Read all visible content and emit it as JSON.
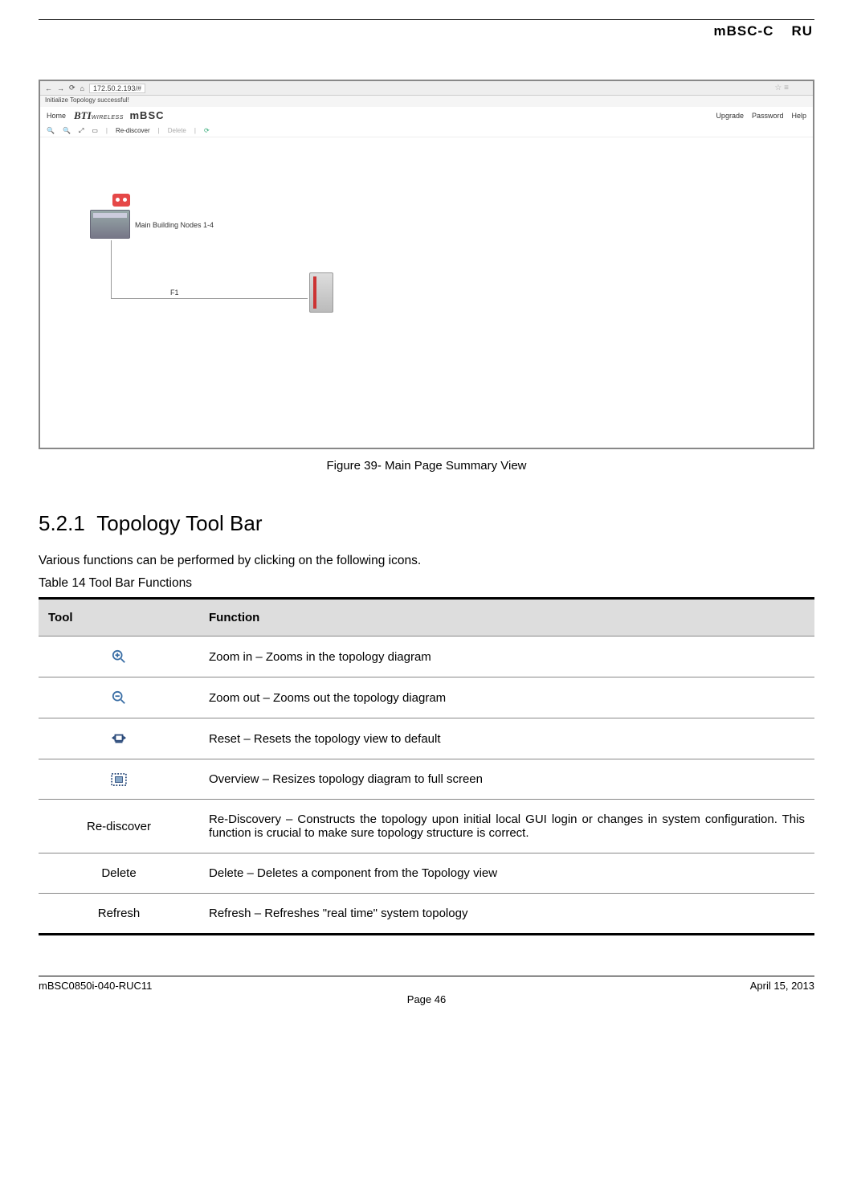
{
  "header": {
    "product": "mBSC-C",
    "unit": "RU"
  },
  "screenshot": {
    "address_bar": "172.50.2.193/#",
    "status_text": "Initialize Topology successful!",
    "top_menu_left": {
      "home": "Home",
      "brand_bti": "BTI",
      "brand_wl": "WIRELESS",
      "brand_mbsc": "mBSC"
    },
    "top_menu_right": {
      "upgrade": "Upgrade",
      "password": "Password",
      "help": "Help"
    },
    "toolbar": {
      "rediscover": "Re-discover",
      "delete": "Delete"
    },
    "host_label": "Main Building Nodes 1-4",
    "f1_label": "F1"
  },
  "figure_caption": "Figure 39- Main Page Summary View",
  "section": {
    "number": "5.2.1",
    "title": "Topology Tool Bar"
  },
  "body_para": "Various functions can be performed by clicking on the following icons.",
  "table_caption": "Table 14 Tool Bar Functions",
  "table": {
    "head_tool": "Tool",
    "head_func": "Function",
    "rows": [
      {
        "tool_type": "icon",
        "icon": "zoom-in",
        "tool_text": "",
        "func": "Zoom in – Zooms in the topology diagram"
      },
      {
        "tool_type": "icon",
        "icon": "zoom-out",
        "tool_text": "",
        "func": "Zoom out – Zooms out the topology diagram"
      },
      {
        "tool_type": "icon",
        "icon": "reset",
        "tool_text": "",
        "func": "Reset – Resets the topology view to default"
      },
      {
        "tool_type": "icon",
        "icon": "overview",
        "tool_text": "",
        "func": "Overview – Resizes topology diagram to full screen"
      },
      {
        "tool_type": "text",
        "icon": "",
        "tool_text": "Re-discover",
        "func": "Re-Discovery – Constructs the topology upon initial local GUI login or changes in system configuration. This function is crucial to make sure topology structure is correct."
      },
      {
        "tool_type": "text",
        "icon": "",
        "tool_text": "Delete",
        "func": "Delete – Deletes a component from the Topology view"
      },
      {
        "tool_type": "text",
        "icon": "",
        "tool_text": "Refresh",
        "func": "Refresh – Refreshes \"real time\" system topology"
      }
    ]
  },
  "footer": {
    "left": "mBSC0850i-040-RUC11",
    "right": "April 15, 2013",
    "page": "Page 46"
  }
}
